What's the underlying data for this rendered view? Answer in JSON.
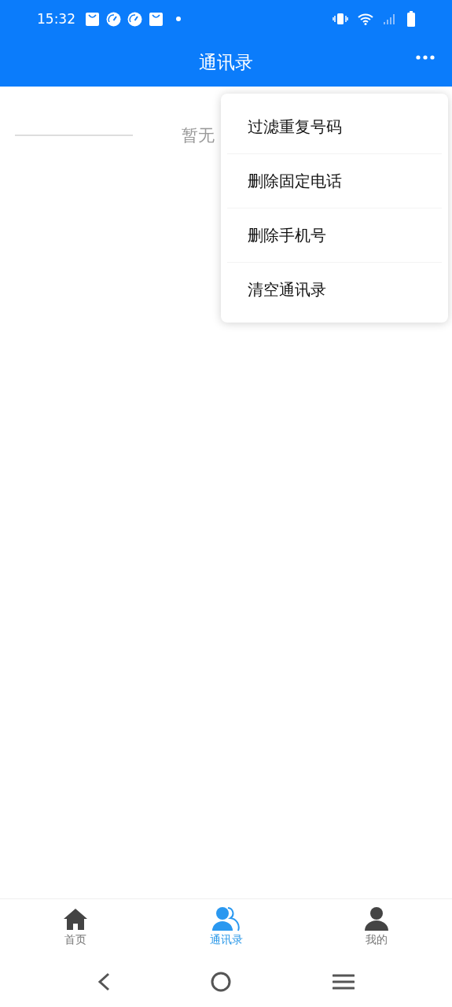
{
  "status_bar": {
    "time": "15:32"
  },
  "header": {
    "title": "通讯录"
  },
  "empty_state": {
    "text": "暂无"
  },
  "menu": {
    "items": [
      {
        "label": "过滤重复号码"
      },
      {
        "label": "删除固定电话"
      },
      {
        "label": "删除手机号"
      },
      {
        "label": "清空通讯录"
      }
    ]
  },
  "tabs": [
    {
      "label": "首页",
      "kind": "home",
      "selected": false
    },
    {
      "label": "通讯录",
      "kind": "contacts",
      "selected": true
    },
    {
      "label": "我的",
      "kind": "profile",
      "selected": false
    }
  ]
}
